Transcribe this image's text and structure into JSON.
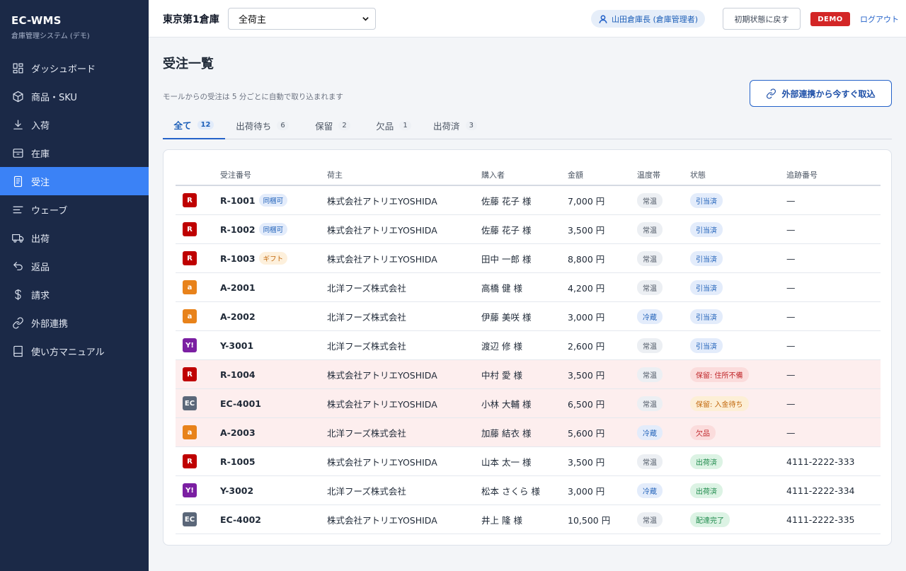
{
  "brand": {
    "title": "EC-WMS",
    "subtitle": "倉庫管理システム (デモ)"
  },
  "sidebar": {
    "items": [
      {
        "label": "ダッシュボード",
        "icon": "dashboard-icon",
        "active": false
      },
      {
        "label": "商品・SKU",
        "icon": "box-icon",
        "active": false
      },
      {
        "label": "入荷",
        "icon": "download-icon",
        "active": false
      },
      {
        "label": "在庫",
        "icon": "archive-icon",
        "active": false
      },
      {
        "label": "受注",
        "icon": "document-icon",
        "active": true
      },
      {
        "label": "ウェーブ",
        "icon": "wave-lines-icon",
        "active": false
      },
      {
        "label": "出荷",
        "icon": "truck-icon",
        "active": false
      },
      {
        "label": "返品",
        "icon": "return-arrow-icon",
        "active": false
      },
      {
        "label": "請求",
        "icon": "dollar-icon",
        "active": false
      },
      {
        "label": "外部連携",
        "icon": "link-icon",
        "active": false
      },
      {
        "label": "使い方マニュアル",
        "icon": "book-icon",
        "active": false
      }
    ]
  },
  "header": {
    "warehouse": "東京第1倉庫",
    "owner_select": "全荷主",
    "user": "山田倉庫長 (倉庫管理者)",
    "reset_label": "初期状態に戻す",
    "demo_label": "DEMO",
    "logout_label": "ログアウト"
  },
  "page": {
    "title": "受注一覧",
    "note": "モールからの受注は 5 分ごとに自動で取り込まれます",
    "import_label": "外部連携から今すぐ取込"
  },
  "tabs": [
    {
      "label": "全て",
      "count": "12",
      "active": true
    },
    {
      "label": "出荷待ち",
      "count": "6",
      "active": false
    },
    {
      "label": "保留",
      "count": "2",
      "active": false
    },
    {
      "label": "欠品",
      "count": "1",
      "active": false
    },
    {
      "label": "出荷済",
      "count": "3",
      "active": false
    }
  ],
  "table": {
    "headers": [
      "受注番号",
      "荷主",
      "購入者",
      "金額",
      "温度帯",
      "状態",
      "追跡番号"
    ],
    "rows": [
      {
        "mall": "R",
        "mall_color": "#bf0000",
        "order": "R-1001",
        "tag": "同梱可",
        "tag_type": "blue",
        "owner": "株式会社アトリエYOSHIDA",
        "buyer": "佐藤 花子 様",
        "amount": "7,000 円",
        "temp": "常温",
        "temp_type": "gray",
        "status": "引当済",
        "status_type": "blue",
        "tracking": "—",
        "alert": false
      },
      {
        "mall": "R",
        "mall_color": "#bf0000",
        "order": "R-1002",
        "tag": "同梱可",
        "tag_type": "blue",
        "owner": "株式会社アトリエYOSHIDA",
        "buyer": "佐藤 花子 様",
        "amount": "3,500 円",
        "temp": "常温",
        "temp_type": "gray",
        "status": "引当済",
        "status_type": "blue",
        "tracking": "—",
        "alert": false
      },
      {
        "mall": "R",
        "mall_color": "#bf0000",
        "order": "R-1003",
        "tag": "ギフト",
        "tag_type": "orange",
        "owner": "株式会社アトリエYOSHIDA",
        "buyer": "田中 一郎 様",
        "amount": "8,800 円",
        "temp": "常温",
        "temp_type": "gray",
        "status": "引当済",
        "status_type": "blue",
        "tracking": "—",
        "alert": false
      },
      {
        "mall": "a",
        "mall_color": "#e8821a",
        "order": "A-2001",
        "tag": "",
        "tag_type": "",
        "owner": "北洋フーズ株式会社",
        "buyer": "高橋 健 様",
        "amount": "4,200 円",
        "temp": "常温",
        "temp_type": "gray",
        "status": "引当済",
        "status_type": "blue",
        "tracking": "—",
        "alert": false
      },
      {
        "mall": "a",
        "mall_color": "#e8821a",
        "order": "A-2002",
        "tag": "",
        "tag_type": "",
        "owner": "北洋フーズ株式会社",
        "buyer": "伊藤 美咲 様",
        "amount": "3,000 円",
        "temp": "冷蔵",
        "temp_type": "cold",
        "status": "引当済",
        "status_type": "blue",
        "tracking": "—",
        "alert": false
      },
      {
        "mall": "Y!",
        "mall_color": "#7b1fa2",
        "order": "Y-3001",
        "tag": "",
        "tag_type": "",
        "owner": "北洋フーズ株式会社",
        "buyer": "渡辺 修 様",
        "amount": "2,600 円",
        "temp": "常温",
        "temp_type": "gray",
        "status": "引当済",
        "status_type": "blue",
        "tracking": "—",
        "alert": false
      },
      {
        "mall": "R",
        "mall_color": "#bf0000",
        "order": "R-1004",
        "tag": "",
        "tag_type": "",
        "owner": "株式会社アトリエYOSHIDA",
        "buyer": "中村 愛 様",
        "amount": "3,500 円",
        "temp": "常温",
        "temp_type": "gray",
        "status": "保留: 住所不備",
        "status_type": "red",
        "tracking": "—",
        "alert": true
      },
      {
        "mall": "EC",
        "mall_color": "#5b6779",
        "order": "EC-4001",
        "tag": "",
        "tag_type": "",
        "owner": "株式会社アトリエYOSHIDA",
        "buyer": "小林 大輔 様",
        "amount": "6,500 円",
        "temp": "常温",
        "temp_type": "gray",
        "status": "保留: 入金待ち",
        "status_type": "orange",
        "tracking": "—",
        "alert": true
      },
      {
        "mall": "a",
        "mall_color": "#e8821a",
        "order": "A-2003",
        "tag": "",
        "tag_type": "",
        "owner": "北洋フーズ株式会社",
        "buyer": "加藤 結衣 様",
        "amount": "5,600 円",
        "temp": "冷蔵",
        "temp_type": "cold",
        "status": "欠品",
        "status_type": "red",
        "tracking": "—",
        "alert": true
      },
      {
        "mall": "R",
        "mall_color": "#bf0000",
        "order": "R-1005",
        "tag": "",
        "tag_type": "",
        "owner": "株式会社アトリエYOSHIDA",
        "buyer": "山本 太一 様",
        "amount": "3,500 円",
        "temp": "常温",
        "temp_type": "gray",
        "status": "出荷済",
        "status_type": "green",
        "tracking": "4111-2222-333",
        "alert": false
      },
      {
        "mall": "Y!",
        "mall_color": "#7b1fa2",
        "order": "Y-3002",
        "tag": "",
        "tag_type": "",
        "owner": "北洋フーズ株式会社",
        "buyer": "松本 さくら 様",
        "amount": "3,000 円",
        "temp": "冷蔵",
        "temp_type": "cold",
        "status": "出荷済",
        "status_type": "green",
        "tracking": "4111-2222-334",
        "alert": false
      },
      {
        "mall": "EC",
        "mall_color": "#5b6779",
        "order": "EC-4002",
        "tag": "",
        "tag_type": "",
        "owner": "株式会社アトリエYOSHIDA",
        "buyer": "井上 隆 様",
        "amount": "10,500 円",
        "temp": "常温",
        "temp_type": "gray",
        "status": "配達完了",
        "status_type": "green",
        "tracking": "4111-2222-335",
        "alert": false
      }
    ]
  },
  "colors": {
    "sidebar_bg": "#1b2947",
    "accent": "#3b82f6",
    "demo_red": "#d32626",
    "alert_row": "#fdeeee"
  }
}
